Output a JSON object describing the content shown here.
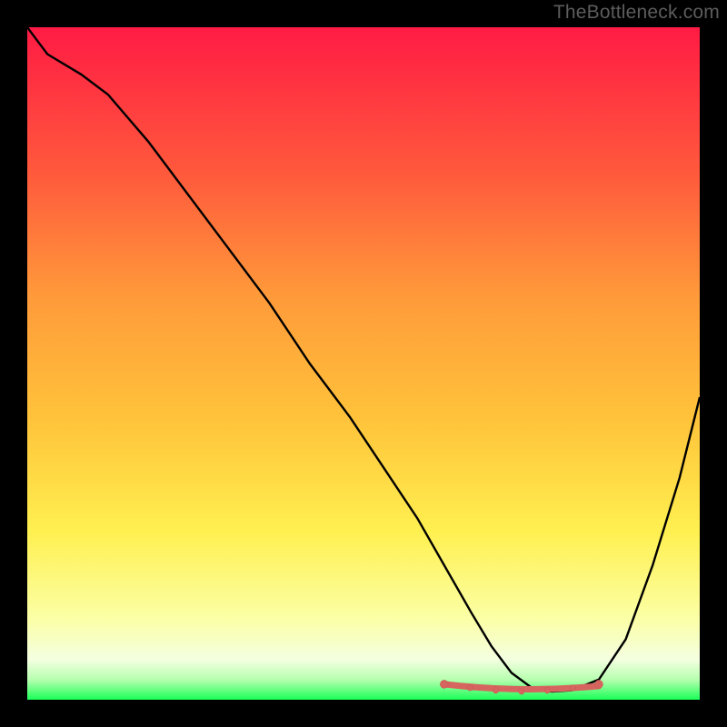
{
  "watermark": "TheBottleneck.com",
  "colors": {
    "bg": "#000000",
    "gradient_top": "#ff1b44",
    "gradient_mid_upper": "#ff6a3a",
    "gradient_mid": "#ffc23a",
    "gradient_mid_lower": "#fff67a",
    "gradient_lower": "#fdffc2",
    "gradient_bottom": "#19ff57",
    "curve": "#000000",
    "marker_fill": "#d6655f",
    "marker_stroke": "#c9544f"
  },
  "chart_data": {
    "type": "line",
    "title": "",
    "xlabel": "",
    "ylabel": "",
    "xlim": [
      0,
      100
    ],
    "ylim": [
      0,
      100
    ],
    "x": [
      0,
      3,
      8,
      12,
      18,
      24,
      30,
      36,
      42,
      48,
      54,
      58,
      62,
      66,
      69,
      72,
      75,
      78,
      81,
      85,
      89,
      93,
      97,
      100
    ],
    "values": [
      100,
      96,
      93,
      90,
      83,
      75,
      67,
      59,
      50,
      42,
      33,
      27,
      20,
      13,
      8,
      4,
      1.8,
      1.2,
      1.4,
      3,
      9,
      20,
      33,
      45
    ],
    "flat_region": {
      "x_start": 62,
      "x_end": 85,
      "y": 1.5
    },
    "green_band": {
      "y_start": 0,
      "y_end": 4
    }
  }
}
